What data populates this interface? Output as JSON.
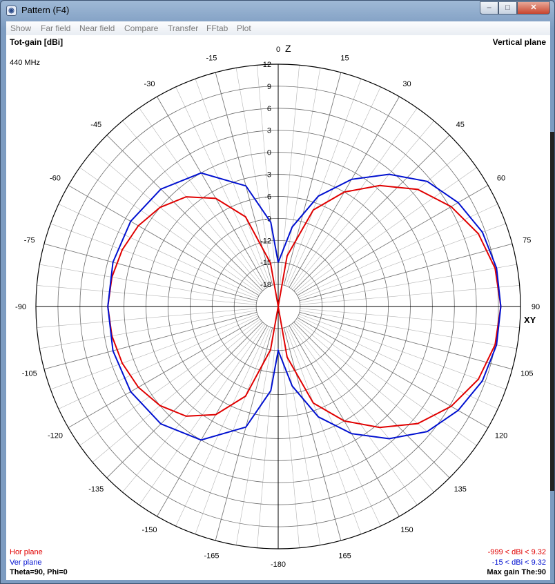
{
  "window": {
    "title": "Pattern   (F4)",
    "icon": "pattern-app-icon",
    "controls": {
      "minimize": "–",
      "maximize": "□",
      "close": "✕"
    }
  },
  "menu": [
    "Show",
    "Far field",
    "Near field",
    "Compare",
    "Transfer",
    "FFtab",
    "Plot"
  ],
  "header": {
    "left_title": "Tot-gain [dBi]",
    "frequency": "440 MHz",
    "right_title": "Vertical plane"
  },
  "axis_labels": {
    "top": "Z",
    "right": "XY"
  },
  "footer": {
    "hor_label": "Hor plane",
    "ver_label": "Ver plane",
    "angles": "Theta=90, Phi=0",
    "hor_range": "-999 < dBi < 9.32",
    "ver_range": "-15 < dBi < 9.32",
    "max_gain": "Max gain The:90"
  },
  "colors": {
    "hor": "#e00000",
    "ver": "#0010d0",
    "grid": "#b4b4b4",
    "gridMajor": "#000000"
  },
  "chart_data": {
    "type": "polar",
    "radial_unit": "dBi",
    "radial_ticks": [
      -18,
      -15,
      -12,
      -9,
      -6,
      -3,
      0,
      3,
      6,
      9,
      12
    ],
    "rlim": [
      -21,
      12
    ],
    "angle_ticks": [
      0,
      15,
      30,
      45,
      60,
      75,
      90,
      105,
      120,
      135,
      150,
      165,
      -180,
      -165,
      -150,
      -135,
      -120,
      -105,
      -90,
      -75,
      -60,
      -45,
      -30,
      -15
    ],
    "series": [
      {
        "name": "Hor plane",
        "points": [
          [
            0,
            -30
          ],
          [
            10,
            -14
          ],
          [
            20,
            -7
          ],
          [
            30,
            -3
          ],
          [
            40,
            0.5
          ],
          [
            50,
            3.8
          ],
          [
            60,
            6.2
          ],
          [
            70,
            8
          ],
          [
            80,
            9
          ],
          [
            90,
            9.32
          ],
          [
            100,
            9
          ],
          [
            110,
            8
          ],
          [
            120,
            6.2
          ],
          [
            130,
            3.8
          ],
          [
            140,
            0.5
          ],
          [
            150,
            -3
          ],
          [
            160,
            -7
          ],
          [
            170,
            -14
          ],
          [
            180,
            -30
          ],
          [
            190,
            -15
          ],
          [
            200,
            -8
          ],
          [
            210,
            -4
          ],
          [
            220,
            -1.5
          ],
          [
            230,
            0
          ],
          [
            240,
            1
          ],
          [
            250,
            1.6
          ],
          [
            260,
            2
          ],
          [
            270,
            2.2
          ],
          [
            280,
            2
          ],
          [
            290,
            1.6
          ],
          [
            300,
            1
          ],
          [
            310,
            0
          ],
          [
            320,
            -1.5
          ],
          [
            330,
            -4
          ],
          [
            340,
            -8
          ],
          [
            350,
            -15
          ],
          [
            360,
            -30
          ]
        ]
      },
      {
        "name": "Ver plane",
        "points": [
          [
            0,
            -15
          ],
          [
            10,
            -10
          ],
          [
            20,
            -5
          ],
          [
            30,
            -1
          ],
          [
            40,
            2.5
          ],
          [
            50,
            5.5
          ],
          [
            60,
            7.3
          ],
          [
            70,
            8.6
          ],
          [
            80,
            9.2
          ],
          [
            90,
            9.32
          ],
          [
            100,
            9.2
          ],
          [
            110,
            8.6
          ],
          [
            120,
            7.3
          ],
          [
            130,
            5.5
          ],
          [
            140,
            2.5
          ],
          [
            150,
            -1
          ],
          [
            160,
            -5
          ],
          [
            170,
            -10
          ],
          [
            180,
            -15
          ],
          [
            185,
            -9.5
          ],
          [
            195,
            -4
          ],
          [
            210,
            0
          ],
          [
            225,
            1.6
          ],
          [
            240,
            2.2
          ],
          [
            255,
            2.3
          ],
          [
            270,
            2.2
          ],
          [
            285,
            2.3
          ],
          [
            300,
            2.2
          ],
          [
            315,
            1.6
          ],
          [
            330,
            0
          ],
          [
            345,
            -4
          ],
          [
            355,
            -9.5
          ],
          [
            360,
            -15
          ]
        ]
      }
    ]
  }
}
